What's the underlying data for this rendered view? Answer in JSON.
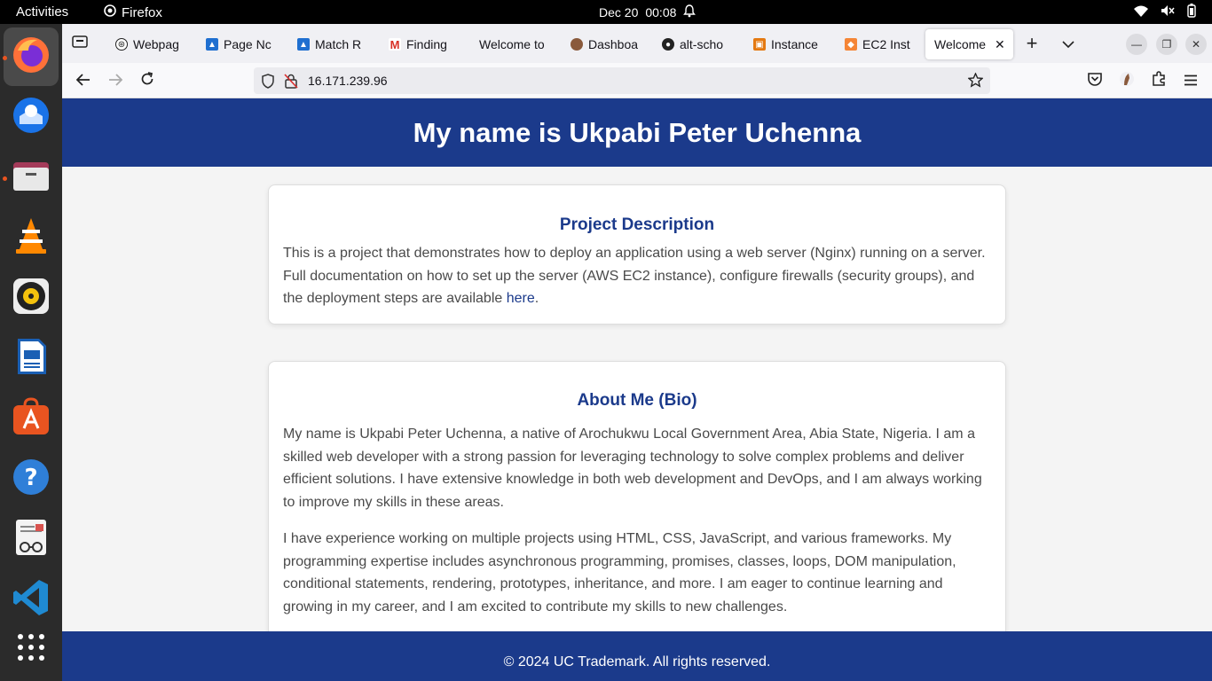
{
  "topbar": {
    "activities": "Activities",
    "app_name": "Firefox",
    "date": "Dec 20",
    "time": "00:08"
  },
  "dock": {
    "items": [
      "firefox-icon",
      "thunderbird-icon",
      "files-icon",
      "vlc-icon",
      "rhythmbox-icon",
      "writer-icon",
      "app-center-icon",
      "help-icon",
      "text-editor-icon",
      "vscode-icon",
      "show-apps-icon"
    ]
  },
  "tabs": [
    {
      "label": "Webpag",
      "favicon": "openai-icon",
      "color": "#222"
    },
    {
      "label": "Page Nc",
      "favicon": "jira-icon",
      "color": "#1f6fd0"
    },
    {
      "label": "Match R",
      "favicon": "jira-icon",
      "color": "#1f6fd0"
    },
    {
      "label": "Finding",
      "favicon": "gmail-icon",
      "color": "#d93025"
    },
    {
      "label": "Welcome to",
      "favicon": "",
      "color": ""
    },
    {
      "label": "Dashboa",
      "favicon": "avatar-icon",
      "color": "#8a5a3c"
    },
    {
      "label": "alt-scho",
      "favicon": "github-icon",
      "color": "#222"
    },
    {
      "label": "Instance",
      "favicon": "aws-icon",
      "color": "#e47911"
    },
    {
      "label": "EC2 Inst",
      "favicon": "ec2-icon",
      "color": "#f58536"
    },
    {
      "label": "Welcome",
      "favicon": "",
      "color": "",
      "active": true
    }
  ],
  "navbar": {
    "url": "16.171.239.96"
  },
  "page": {
    "hero_title": "My name is Ukpabi Peter Uchenna",
    "project": {
      "heading": "Project Description",
      "text": "This is a project that demonstrates how to deploy an application using a web server (Nginx) running on a server. Full documentation on how to set up the server (AWS EC2 instance), configure firewalls (security groups), and the deployment steps are available ",
      "link": "here",
      "after_link": "."
    },
    "about": {
      "heading": "About Me (Bio)",
      "para1": "My name is Ukpabi Peter Uchenna, a native of Arochukwu Local Government Area, Abia State, Nigeria. I am a skilled web developer with a strong passion for leveraging technology to solve complex problems and deliver efficient solutions. I have extensive knowledge in both web development and DevOps, and I am always working to improve my skills in these areas.",
      "para2": "I have experience working on multiple projects using HTML, CSS, JavaScript, and various frameworks. My programming expertise includes asynchronous programming, promises, classes, loops, DOM manipulation, conditional statements, rendering, prototypes, inheritance, and more. I am eager to continue learning and growing in my career, and I am excited to contribute my skills to new challenges."
    },
    "footer": "© 2024 UC Trademark. All rights reserved."
  },
  "colors": {
    "brand": "#1b3a8b",
    "accent": "#e95420"
  }
}
